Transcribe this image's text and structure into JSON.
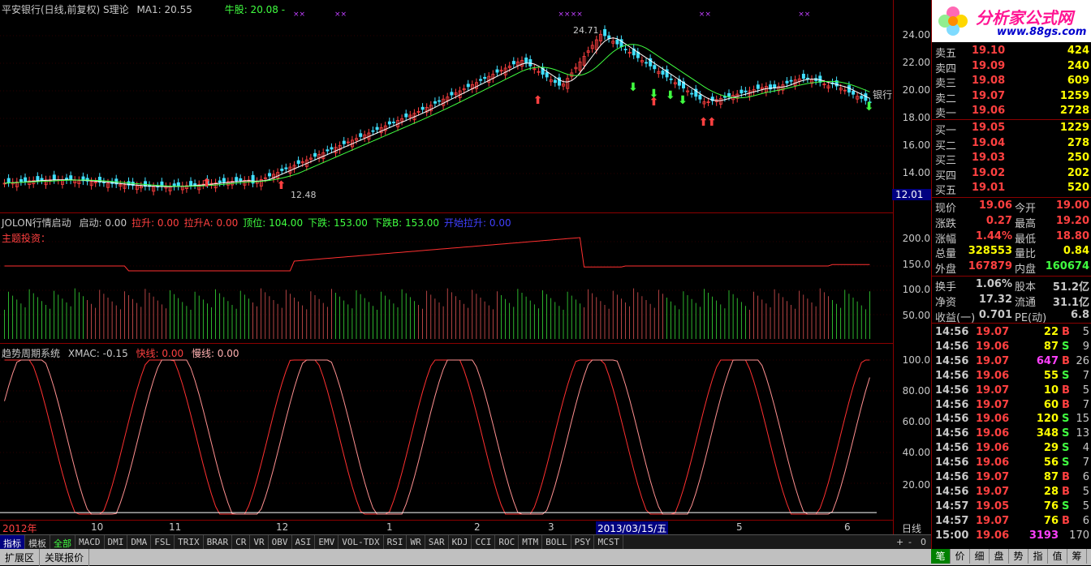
{
  "main_header": {
    "title": "平安银行(日线,前复权) S理论",
    "ma_label": "MA1: 20.55",
    "bull_label": "牛股: 20.08 -"
  },
  "price_axis": [
    "24.00",
    "22.00",
    "20.00",
    "18.00",
    "16.00",
    "14.00"
  ],
  "price_marker": "12.01",
  "annotations": {
    "high": "24.71",
    "low": "12.48",
    "stock_tag": "银行"
  },
  "ind1_header": {
    "name": "JOLON行情启动",
    "items": [
      {
        "label": "启动: 0.00",
        "color": "#c8c8c8"
      },
      {
        "label": "拉升: 0.00",
        "color": "#ff4040"
      },
      {
        "label": "拉升A: 0.00",
        "color": "#ff4040"
      },
      {
        "label": "顶位: 104.00",
        "color": "#40ff40"
      },
      {
        "label": "下跌: 153.00",
        "color": "#40ff40"
      },
      {
        "label": "下跌B: 153.00",
        "color": "#40ff40"
      },
      {
        "label": "开始拉升: 0.00",
        "color": "#4040ff"
      }
    ],
    "sub": "主题投资："
  },
  "ind1_axis": [
    "200.0",
    "150.0",
    "100.0",
    "50.00"
  ],
  "ind2_header": {
    "name": "趋势周期系统",
    "xmac": "XMAC: -0.15",
    "fast": "快线: 0.00",
    "slow": "慢线: 0.00"
  },
  "ind2_axis": [
    "100.0",
    "80.00",
    "60.00",
    "40.00",
    "20.00"
  ],
  "date_axis": {
    "labels": [
      "2012年",
      "10",
      "11",
      "12",
      "1",
      "2",
      "3",
      "2013/03/15/五",
      "5",
      "6"
    ],
    "period": "日线"
  },
  "indicator_tabs": [
    "指标",
    "模板",
    "全部",
    "MACD",
    "DMI",
    "DMA",
    "FSL",
    "TRIX",
    "BRAR",
    "CR",
    "VR",
    "OBV",
    "ASI",
    "EMV",
    "VOL-TDX",
    "RSI",
    "WR",
    "SAR",
    "KDJ",
    "CCI",
    "ROC",
    "MTM",
    "BOLL",
    "PSY",
    "MCST"
  ],
  "bottom_tabs": [
    "扩展区",
    "关联报价"
  ],
  "zoom_controls": [
    "+",
    "-",
    "0"
  ],
  "logo": {
    "brand": "分析家公式网",
    "url": "www.88gs.com"
  },
  "order_book": {
    "sell": [
      {
        "label": "卖五",
        "price": "19.10",
        "vol": "424"
      },
      {
        "label": "卖四",
        "price": "19.09",
        "vol": "240"
      },
      {
        "label": "卖三",
        "price": "19.08",
        "vol": "609"
      },
      {
        "label": "卖二",
        "price": "19.07",
        "vol": "1259"
      },
      {
        "label": "卖一",
        "price": "19.06",
        "vol": "2728"
      }
    ],
    "buy": [
      {
        "label": "买一",
        "price": "19.05",
        "vol": "1229"
      },
      {
        "label": "买二",
        "price": "19.04",
        "vol": "278"
      },
      {
        "label": "买三",
        "price": "19.03",
        "vol": "250"
      },
      {
        "label": "买四",
        "price": "19.02",
        "vol": "202"
      },
      {
        "label": "买五",
        "price": "19.01",
        "vol": "520"
      }
    ]
  },
  "stats": [
    {
      "l1": "现价",
      "v1": "19.06",
      "c1": "#ff4040",
      "l2": "今开",
      "v2": "19.00",
      "c2": "#ff4040"
    },
    {
      "l1": "涨跌",
      "v1": "0.27",
      "c1": "#ff4040",
      "l2": "最高",
      "v2": "19.20",
      "c2": "#ff4040"
    },
    {
      "l1": "涨幅",
      "v1": "1.44%",
      "c1": "#ff4040",
      "l2": "最低",
      "v2": "18.80",
      "c2": "#ff4040"
    },
    {
      "l1": "总量",
      "v1": "328553",
      "c1": "#ffff00",
      "l2": "量比",
      "v2": "0.84",
      "c2": "#ffff00"
    },
    {
      "l1": "外盘",
      "v1": "167879",
      "c1": "#ff4040",
      "l2": "内盘",
      "v2": "160674",
      "c2": "#40ff40"
    },
    {
      "l1": "换手",
      "v1": "1.06%",
      "c1": "#c8c8c8",
      "l2": "股本",
      "v2": "51.2亿",
      "c2": "#c8c8c8"
    },
    {
      "l1": "净资",
      "v1": "17.32",
      "c1": "#c8c8c8",
      "l2": "流通",
      "v2": "31.1亿",
      "c2": "#c8c8c8"
    },
    {
      "l1": "收益(一)",
      "v1": "0.701",
      "c1": "#c8c8c8",
      "l2": "PE(动)",
      "v2": "6.8",
      "c2": "#c8c8c8"
    }
  ],
  "ticks": [
    {
      "t": "14:56",
      "p": "19.07",
      "pc": "#ff4040",
      "v": "22",
      "vc": "#ffff00",
      "d": "B",
      "dc": "#ff4040",
      "n": "5"
    },
    {
      "t": "14:56",
      "p": "19.06",
      "pc": "#ff4040",
      "v": "87",
      "vc": "#ffff00",
      "d": "S",
      "dc": "#40ff40",
      "n": "9"
    },
    {
      "t": "14:56",
      "p": "19.07",
      "pc": "#ff4040",
      "v": "647",
      "vc": "#ff40ff",
      "d": "B",
      "dc": "#ff4040",
      "n": "26"
    },
    {
      "t": "14:56",
      "p": "19.06",
      "pc": "#ff4040",
      "v": "55",
      "vc": "#ffff00",
      "d": "S",
      "dc": "#40ff40",
      "n": "7"
    },
    {
      "t": "14:56",
      "p": "19.07",
      "pc": "#ff4040",
      "v": "10",
      "vc": "#ffff00",
      "d": "B",
      "dc": "#ff4040",
      "n": "5"
    },
    {
      "t": "14:56",
      "p": "19.07",
      "pc": "#ff4040",
      "v": "60",
      "vc": "#ffff00",
      "d": "B",
      "dc": "#ff4040",
      "n": "7"
    },
    {
      "t": "14:56",
      "p": "19.06",
      "pc": "#ff4040",
      "v": "120",
      "vc": "#ffff00",
      "d": "S",
      "dc": "#40ff40",
      "n": "15"
    },
    {
      "t": "14:56",
      "p": "19.06",
      "pc": "#ff4040",
      "v": "348",
      "vc": "#ffff00",
      "d": "S",
      "dc": "#40ff40",
      "n": "13"
    },
    {
      "t": "14:56",
      "p": "19.06",
      "pc": "#ff4040",
      "v": "29",
      "vc": "#ffff00",
      "d": "S",
      "dc": "#40ff40",
      "n": "4"
    },
    {
      "t": "14:56",
      "p": "19.06",
      "pc": "#ff4040",
      "v": "56",
      "vc": "#ffff00",
      "d": "S",
      "dc": "#40ff40",
      "n": "7"
    },
    {
      "t": "14:56",
      "p": "19.07",
      "pc": "#ff4040",
      "v": "87",
      "vc": "#ffff00",
      "d": "B",
      "dc": "#ff4040",
      "n": "6"
    },
    {
      "t": "14:56",
      "p": "19.07",
      "pc": "#ff4040",
      "v": "28",
      "vc": "#ffff00",
      "d": "B",
      "dc": "#ff4040",
      "n": "5"
    },
    {
      "t": "14:57",
      "p": "19.05",
      "pc": "#ff4040",
      "v": "76",
      "vc": "#ffff00",
      "d": "S",
      "dc": "#40ff40",
      "n": "5"
    },
    {
      "t": "14:57",
      "p": "19.07",
      "pc": "#ff4040",
      "v": "76",
      "vc": "#ffff00",
      "d": "B",
      "dc": "#ff4040",
      "n": "6"
    },
    {
      "t": "15:00",
      "p": "19.06",
      "pc": "#ff4040",
      "v": "3193",
      "vc": "#ff40ff",
      "d": "",
      "dc": "#ff4040",
      "n": "170"
    }
  ],
  "right_tabs": [
    "笔",
    "价",
    "细",
    "盘",
    "势",
    "指",
    "值",
    "筹"
  ],
  "colors": {
    "up": "#ff4040",
    "down": "#40ff40",
    "grid": "#8b0000",
    "axis_text": "#c8c8c8"
  }
}
